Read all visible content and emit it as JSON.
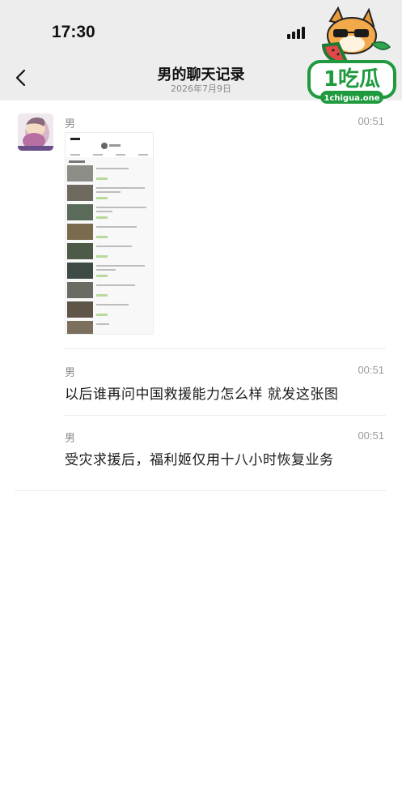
{
  "status_bar": {
    "time": "17:30"
  },
  "nav": {
    "title": "男的聊天记录",
    "date": "2026年7月9日"
  },
  "logo": {
    "text": "1吃瓜",
    "domain": "1chigua.one"
  },
  "messages": [
    {
      "sender": "男",
      "time": "00:51",
      "type": "image"
    },
    {
      "sender": "男",
      "time": "00:51",
      "type": "text",
      "text": "以后谁再问中国救援能力怎么样 就发这张图"
    },
    {
      "sender": "男",
      "time": "00:51",
      "type": "text",
      "text": "受灾求援后，福利姬仅用十八小时恢复业务"
    }
  ],
  "icons": [
    "signal-icon",
    "back-icon",
    "avatar-image"
  ],
  "colors": {
    "header_bg": "#ededed",
    "text": "#1a1a1a",
    "meta": "#8a8a8a",
    "logo_green": "#1f9a3e"
  }
}
